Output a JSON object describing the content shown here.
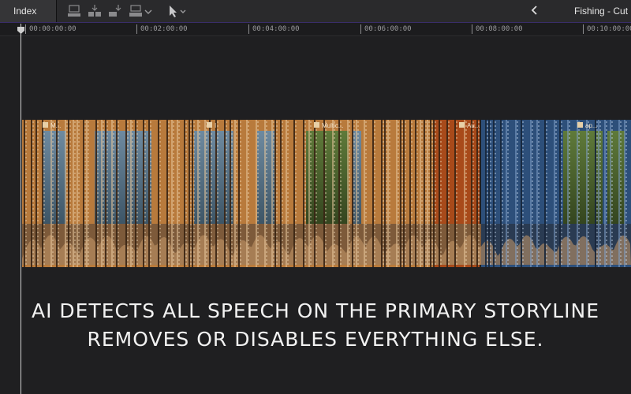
{
  "toolbar": {
    "index_label": "Index",
    "project_title": "Fishing - Cut",
    "icons": [
      "connect-icon",
      "insert-icon",
      "append-icon",
      "overwrite-icon",
      "select-tool-icon",
      "back-chevron-icon"
    ]
  },
  "ruler": {
    "timecodes": [
      "00:00:00:00",
      "00:02:00:00",
      "00:04:00:00",
      "00:06:00:00",
      "00:08:00:00",
      "00:10:00:00"
    ]
  },
  "clips": {
    "labels": [
      "M...",
      "I",
      "Multic...",
      "Au...",
      "ap..."
    ]
  },
  "caption": {
    "line1": "AI DETECTS ALL SPEECH ON THE PRIMARY STORYLINE",
    "line2": "REMOVES OR DISABLES EVERYTHING ELSE."
  },
  "colors": {
    "clip_orange": "#b87a3c",
    "clip_blue": "#2d4f7a",
    "audio_orange": "#c89a6a",
    "selection_purple": "#3a2d6a"
  }
}
